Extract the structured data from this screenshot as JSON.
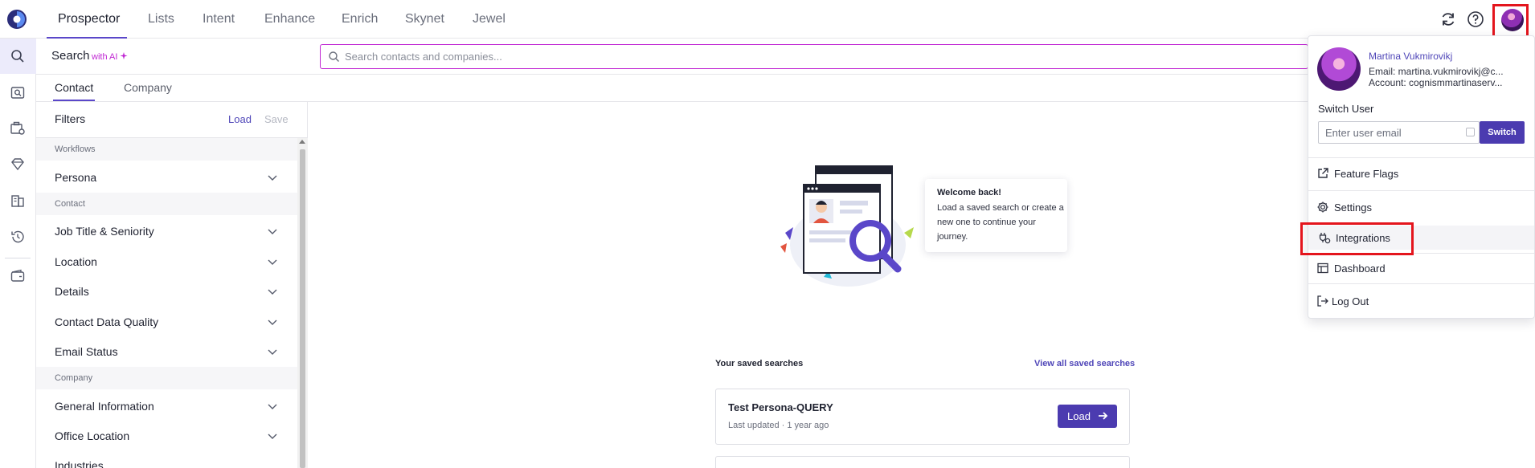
{
  "nav": {
    "tabs": [
      "Prospector",
      "Lists",
      "Intent",
      "Enhance",
      "Enrich",
      "Skynet",
      "Jewel"
    ],
    "active_tab": "Prospector",
    "icons": [
      "refresh-icon",
      "help-icon",
      "user-avatar"
    ]
  },
  "rail": {
    "icons": [
      "search-icon",
      "saved-search-icon",
      "company-search-icon",
      "gem-icon",
      "building-icon",
      "history-icon",
      "wallet-icon"
    ]
  },
  "search": {
    "title": "Search",
    "ai_badge": "with AI",
    "placeholder": "Search contacts and companies..."
  },
  "subtabs": {
    "contact": "Contact",
    "company": "Company"
  },
  "filters": {
    "title": "Filters",
    "load": "Load",
    "save": "Save",
    "sections": [
      {
        "label": "Workflows",
        "items": [
          "Persona"
        ]
      },
      {
        "label": "Contact",
        "items": [
          "Job Title & Seniority",
          "Location",
          "Details",
          "Contact Data Quality",
          "Email Status"
        ]
      },
      {
        "label": "Company",
        "items": [
          "General Information",
          "Office Location",
          "Industries"
        ]
      }
    ]
  },
  "welcome": {
    "title": "Welcome back!",
    "body": "Load a saved search or create a new one to continue your journey."
  },
  "saved_searches": {
    "title": "Your saved searches",
    "view_all": "View all saved searches",
    "items": [
      {
        "name": "Test Persona-QUERY",
        "updated": "Last updated · 1 year ago",
        "action": "Load"
      }
    ]
  },
  "user_menu": {
    "name": "Martina Vukmirovikj",
    "email": "Email: martina.vukmirovikj@c...",
    "account": "Account: cognismmartinaserv...",
    "switch_label": "Switch User",
    "switch_placeholder": "Enter user email",
    "switch_button": "Switch",
    "items": [
      {
        "label": "Feature Flags",
        "icon": "external-link-icon"
      },
      {
        "label": "Settings",
        "icon": "gear-icon"
      },
      {
        "label": "Integrations",
        "icon": "plug-icon"
      },
      {
        "label": "Dashboard",
        "icon": "dashboard-icon"
      },
      {
        "label": "Log Out",
        "icon": "logout-icon"
      }
    ]
  },
  "colors": {
    "accent": "#4b3bb0",
    "ai_magenta": "#c026d3",
    "highlight_red": "#e4151d"
  }
}
